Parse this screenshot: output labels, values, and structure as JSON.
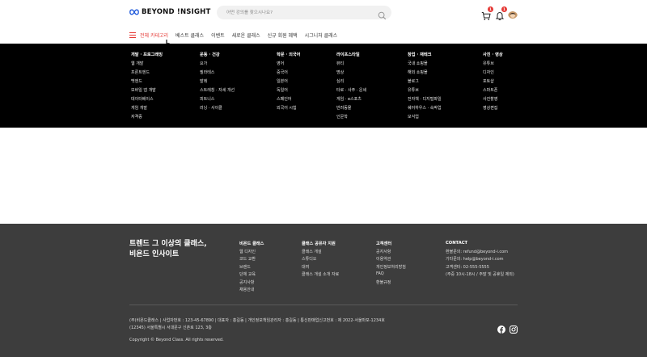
{
  "header": {
    "logo_text": "BEYOND !NSIGHT",
    "search_placeholder": "어떤 강의를 찾으시나요?",
    "cart_count": "1",
    "notification_count": "1",
    "brand_color": "#e53935"
  },
  "nav": {
    "items": [
      "전체 카테고리",
      "베스트 클래스",
      "이벤트",
      "새로운 클래스",
      "신규 회원 혜택",
      "시그니처 클래스"
    ]
  },
  "mega_menu": {
    "columns": [
      {
        "title": "개발 · 프로그래밍",
        "items": [
          "웹 개발",
          "프론트엔드",
          "백엔드",
          "모바일 앱 개발",
          "데이터베이스",
          "게임 개발",
          "자격증"
        ]
      },
      {
        "title": "운동 · 건강",
        "items": [
          "요가",
          "필라테스",
          "발레",
          "스트레칭 · 자세 개선",
          "피트니스",
          "러닝 · 사이클"
        ]
      },
      {
        "title": "학문 · 외국어",
        "items": [
          "영어",
          "중국어",
          "일본어",
          "독일어",
          "스페인어",
          "외국어 시험"
        ]
      },
      {
        "title": "라이프스타일",
        "items": [
          "뷰티",
          "명상",
          "심리",
          "타로 · 사주 · 운세",
          "게임 · e스포츠",
          "반려동물",
          "인문학"
        ]
      },
      {
        "title": "창업 · 재테크",
        "items": [
          "국내 쇼핑몰",
          "해외 쇼핑몰",
          "블로그",
          "유튜브",
          "전자책 · 디지털파일",
          "쉐어하우스 · 숙박업",
          "모식업"
        ]
      },
      {
        "title": "사진 · 영상",
        "items": [
          "유튜브",
          "디자인",
          "포토샵",
          "스마트폰",
          "사진촬영",
          "영상편집"
        ]
      }
    ]
  },
  "footer": {
    "tagline_line1": "트렌드 그 이상의 클래스,",
    "tagline_line2": "비욘드 인사이트",
    "columns": [
      {
        "title": "비욘드 클래스",
        "items": [
          "웹 디자인",
          "코드 교환",
          "브랜드",
          "단체 교육",
          "공지사항",
          "채용안내"
        ]
      },
      {
        "title": "클래스 공유자 지원",
        "items": [
          "클래스 개설",
          "스튜디오",
          "대여",
          "클래스 개설 소개 자료"
        ]
      },
      {
        "title": "고객센터",
        "items": [
          "공지사항",
          "이용약관",
          "개인정보처리방침",
          "FAQ",
          "환불규정"
        ]
      },
      {
        "title": "CONTACT",
        "items": [
          "환불문의: refund@beyond-i.com",
          "기타문의: help@beyond-i.com",
          "고객센터: 02-555-5555",
          "(주중 10시-18시 / 주말 및 공휴일 제외)"
        ]
      }
    ],
    "corp_line1": "(주)비욘드클래스  |  사업자번호 : 123-45-67890  |  대표자 : 홍길동  |  개인정보책임관리자 : 홍길동  |  통신판매업신고번호 : 제 2022-서울마포-1234호",
    "corp_line2": "(12345) 서울특별시 서대문구 신촌로 123, 3층",
    "copyright": "Copyright © Beyond Class. All rights reserved."
  }
}
